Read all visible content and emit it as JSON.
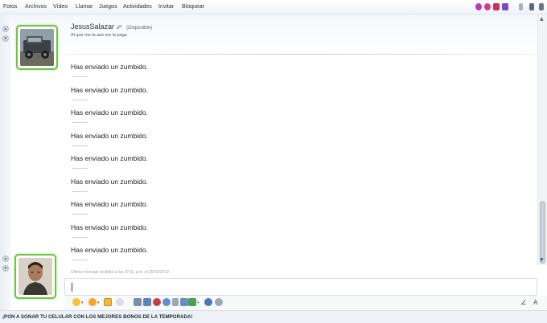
{
  "menu": {
    "items": [
      "Fotos",
      "Archivos",
      "Vídeo",
      "Llamar",
      "Juegos",
      "Actividades",
      "Invitar",
      "Bloquear"
    ]
  },
  "contact": {
    "name": "JesusSalazar",
    "status": "(Disponible)",
    "personal_message": "Al que me la ase me la paga"
  },
  "conversation": {
    "messages": [
      "Has enviado un zumbido.",
      "Has enviado un zumbido.",
      "Has enviado un zumbido.",
      "Has enviado un zumbido.",
      "Has enviado un zumbido.",
      "Has enviado un zumbido.",
      "Has enviado un zumbido.",
      "Has enviado un zumbido.",
      "Has enviado un zumbido."
    ],
    "last_received": "Último mensaje recibido a las 07:31 p.m. el 20/02/2012."
  },
  "compose": {
    "value": ""
  },
  "toolbar": {
    "font_label": "A"
  },
  "ad": {
    "text": "¡PON A SONAR TU CELULAR CON LOS MEJORES BONOS DE LA TEMPORADA!"
  },
  "colors": {
    "avatar_frame": "#6cc642",
    "menubar": "#eef3f8",
    "nudge_icon": "#f2b83a"
  }
}
